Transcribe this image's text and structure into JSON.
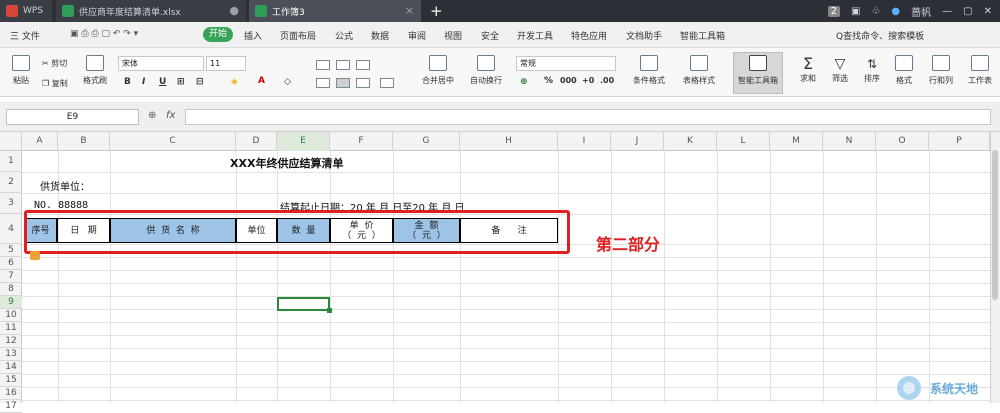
{
  "titlebar": {
    "wps_label": "WPS",
    "tabs": [
      "供应商年度结算清单.xlsx",
      "工作簿3"
    ],
    "badge": "2",
    "user": "蔷帆"
  },
  "menu": {
    "file": "三 文件",
    "items": [
      "开始",
      "插入",
      "页面布局",
      "公式",
      "数据",
      "审阅",
      "视图",
      "安全",
      "开发工具",
      "特色应用",
      "文档助手",
      "智能工具箱"
    ],
    "search": "Q查找命令、搜索模板"
  },
  "ribbon": {
    "paste": "粘贴",
    "cut": "剪切",
    "copy": "复制",
    "format_painter": "格式刷",
    "font_name": "宋体",
    "font_size": "11",
    "merge": "合并居中",
    "wrap": "自动换行",
    "number_format": "常规",
    "conditional": "条件格式",
    "table_style": "表格样式",
    "smart_toolbox": "智能工具箱",
    "sum": "求和",
    "filter": "筛选",
    "sort": "排序",
    "format": "格式",
    "rowcol": "行和列",
    "worksheet": "工作表"
  },
  "formula_bar": {
    "name_box": "E9",
    "fx": "fx",
    "value": ""
  },
  "columns": [
    "A",
    "B",
    "C",
    "D",
    "E",
    "F",
    "G",
    "H",
    "I",
    "J",
    "K",
    "L",
    "M",
    "N",
    "O",
    "P"
  ],
  "rows": [
    "1",
    "2",
    "3",
    "4",
    "5",
    "6",
    "7",
    "8",
    "9",
    "10",
    "11",
    "12",
    "13",
    "14",
    "15",
    "16",
    "17"
  ],
  "sheet": {
    "title": "XXX年终供应结算清单",
    "supplier": "供货单位：",
    "no": "NO. 88888",
    "period": "结算起止日期：20    年   月  日至20    年   月   日",
    "headers": [
      "序号",
      "日   期",
      "供  货  名  称",
      "单位",
      "数  量",
      "单  价\n（  元  ）",
      "金  额\n（  元  ）",
      "备      注"
    ]
  },
  "annotation": "第二部分",
  "watermark": "系统天地"
}
